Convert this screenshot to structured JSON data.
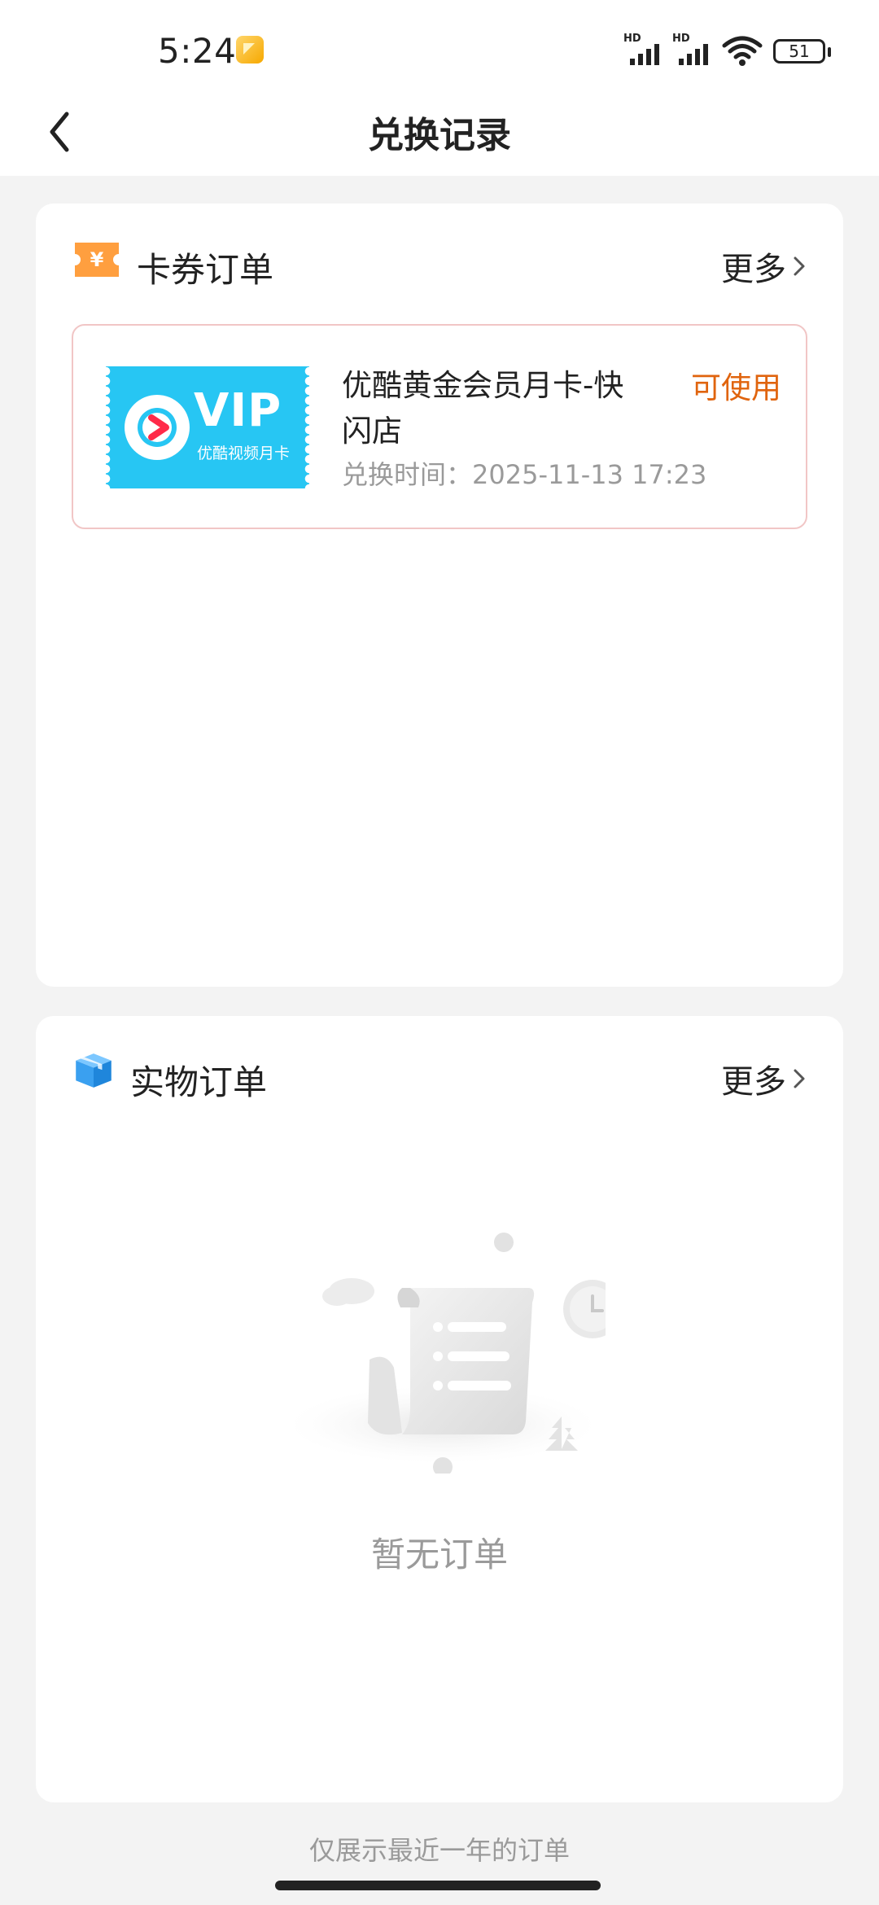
{
  "status_bar": {
    "time": "5:24",
    "signal_1_label": "HD",
    "signal_2_label": "HD",
    "battery": "51",
    "icons": [
      "app-notification-icon",
      "signal-icon",
      "signal-icon",
      "wifi-icon",
      "battery-icon"
    ]
  },
  "nav": {
    "title": "兑换记录",
    "back_icon": "chevron-left-icon"
  },
  "card_orders": {
    "title": "卡券订单",
    "more_label": "更多",
    "icon": "ticket-yen-icon",
    "items": [
      {
        "thumb_title": "VIP",
        "thumb_subtitle": "优酷视频月卡",
        "name": "优酷黄金会员月卡-快闪店",
        "status": "可使用",
        "time_label": "兑换时间：",
        "time_value": "2025-11-13 17:23"
      }
    ]
  },
  "physical_orders": {
    "title": "实物订单",
    "more_label": "更多",
    "icon": "box-icon",
    "empty_text": "暂无订单"
  },
  "footer_note": "仅展示最近一年的订单",
  "colors": {
    "accent_orange": "#e0640e",
    "vip_blue": "#27c6f3",
    "ticket_orange": "#ff9f3f",
    "box_blue": "#3aa0f0"
  }
}
